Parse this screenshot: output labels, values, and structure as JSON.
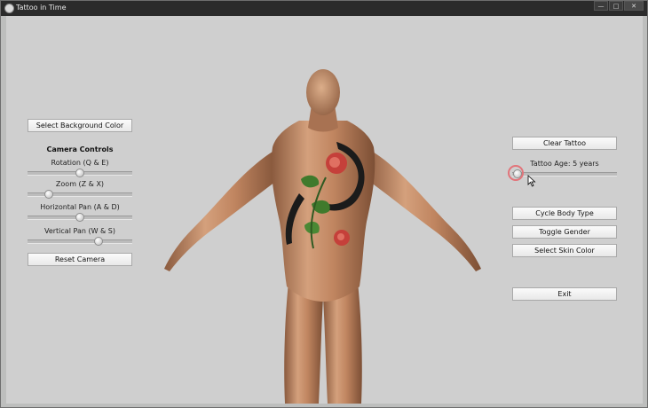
{
  "window": {
    "title": "Tattoo in Time",
    "controls": {
      "minimize": "—",
      "maximize": "□",
      "close": "✕"
    }
  },
  "left_panel": {
    "background_button": "Select Background Color",
    "camera_heading": "Camera Controls",
    "sliders": [
      {
        "label": "Rotation (Q & E)",
        "value": 0.5
      },
      {
        "label": "Zoom (Z & X)",
        "value": 0.2
      },
      {
        "label": "Horizontal Pan (A & D)",
        "value": 0.5
      },
      {
        "label": "Vertical Pan (W & S)",
        "value": 0.68
      }
    ],
    "reset_button": "Reset Camera"
  },
  "right_panel": {
    "clear_button": "Clear Tattoo",
    "age_label": "Tattoo Age: 5 years",
    "age_value": 0.05,
    "body_type_button": "Cycle Body Type",
    "gender_button": "Toggle Gender",
    "skin_button": "Select Skin Color",
    "exit_button": "Exit"
  },
  "colors": {
    "viewport_bg": "#cfcfcf",
    "skin": "#c6906c",
    "tattoo_rose": "#c5403a",
    "tattoo_leaf": "#3f7a2c",
    "cursor_ring": "#e2747a"
  }
}
